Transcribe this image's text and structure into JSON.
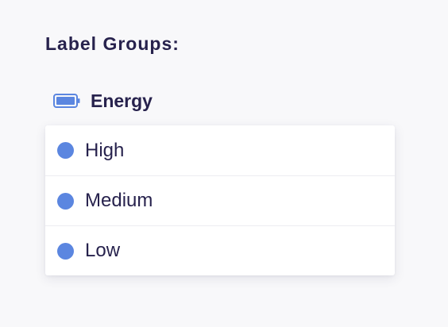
{
  "section": {
    "title": "Label Groups:"
  },
  "group": {
    "name": "Energy",
    "icon": "battery-icon",
    "icon_color": "#5b86e0",
    "labels": [
      {
        "label": "High",
        "color": "#5b86e0"
      },
      {
        "label": "Medium",
        "color": "#5b86e0"
      },
      {
        "label": "Low",
        "color": "#5b86e0"
      }
    ]
  }
}
